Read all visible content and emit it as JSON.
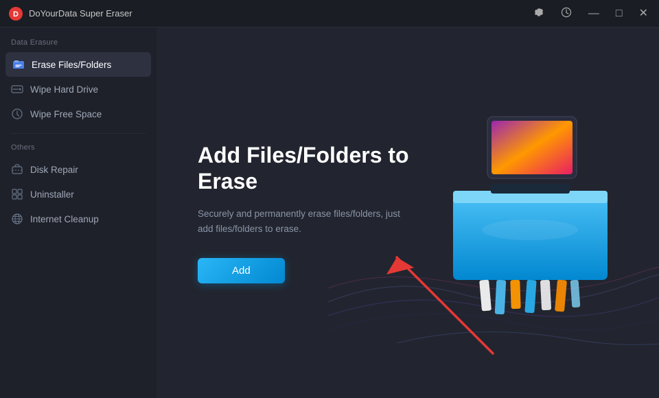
{
  "app": {
    "title": "DoYourData Super Eraser",
    "icon": "🛡️"
  },
  "titlebar": {
    "controls": {
      "settings_label": "⚙",
      "history_label": "🕐",
      "minimize_label": "—",
      "maximize_label": "□",
      "close_label": "✕"
    }
  },
  "sidebar": {
    "data_erasure_label": "Data Erasure",
    "items": [
      {
        "id": "erase-files",
        "label": "Erase Files/Folders",
        "active": true,
        "icon": "folder-shred"
      },
      {
        "id": "wipe-hard-drive",
        "label": "Wipe Hard Drive",
        "active": false,
        "icon": "hard-drive"
      },
      {
        "id": "wipe-free-space",
        "label": "Wipe Free Space",
        "active": false,
        "icon": "clock-circle"
      }
    ],
    "others_label": "Others",
    "others_items": [
      {
        "id": "disk-repair",
        "label": "Disk Repair",
        "icon": "briefcase"
      },
      {
        "id": "uninstaller",
        "label": "Uninstaller",
        "icon": "grid"
      },
      {
        "id": "internet-cleanup",
        "label": "Internet Cleanup",
        "icon": "globe"
      }
    ]
  },
  "main": {
    "title": "Add Files/Folders to Erase",
    "description": "Securely and permanently erase files/folders, just add files/folders to erase.",
    "add_button_label": "Add"
  },
  "colors": {
    "accent": "#29b6f6",
    "bg_dark": "#1a1d24",
    "bg_sidebar": "#1e2129",
    "bg_main": "#22252f",
    "active_item": "#2d3140"
  }
}
